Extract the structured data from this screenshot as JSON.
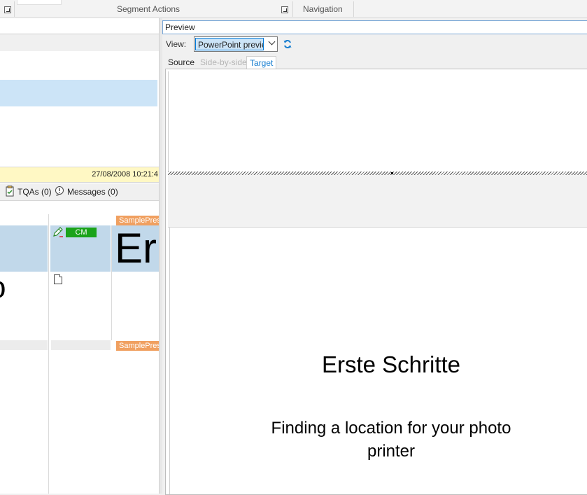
{
  "ribbon": {
    "groups": [
      {
        "label": "Segment Actions"
      },
      {
        "label": "Navigation"
      }
    ]
  },
  "left_pane": {
    "timestamp": "27/08/2008 10:21:4",
    "status": {
      "tqas": "TQAs (0)",
      "messages": "Messages (0)"
    },
    "segment": {
      "match_badge": "CM",
      "tag_open": "SamplePres",
      "tag_close": "SamplePres",
      "target_text_fragment": "Er",
      "source_text_fragment": "o"
    }
  },
  "preview": {
    "title": "Preview",
    "view_label": "View:",
    "view_value": "PowerPoint previe",
    "tabs": [
      {
        "label": "Source",
        "state": "normal"
      },
      {
        "label": "Side-by-side",
        "state": "disabled"
      },
      {
        "label": "Target",
        "state": "active"
      }
    ],
    "slide": {
      "title": "Erste Schritte",
      "subtitle_line1": "Finding a location for your photo",
      "subtitle_line2": "printer"
    }
  },
  "colors": {
    "accent": "#1a7fd0",
    "selection": "#cce4f7",
    "match_green": "#1aa31a",
    "tag_orange": "#f0a060",
    "date_bg": "#fff8c4"
  },
  "icons": {
    "refresh": "refresh-icon",
    "tqa": "tqa-icon",
    "messages": "messages-icon",
    "edit": "pencil-icon",
    "document": "document-icon"
  }
}
